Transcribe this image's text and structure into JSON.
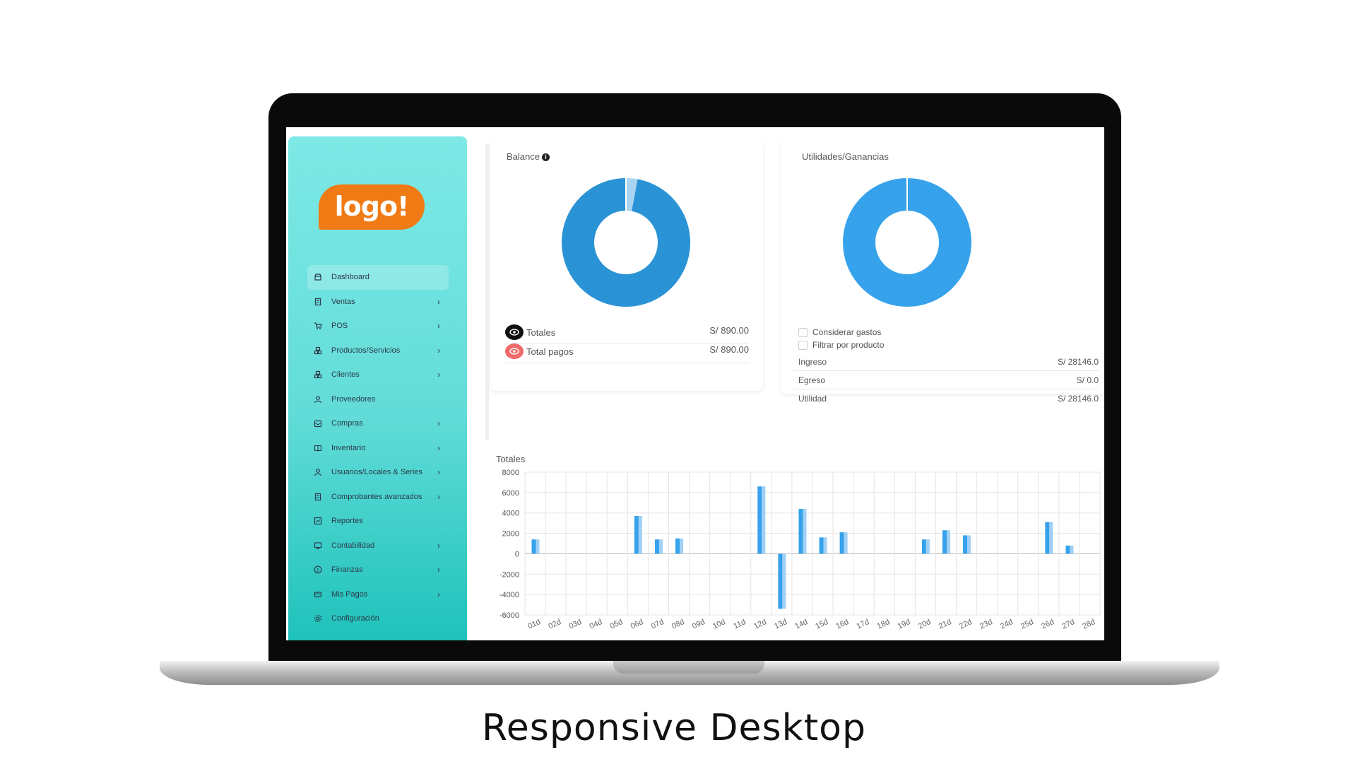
{
  "caption": "Responsive Desktop",
  "logo": {
    "text": "logo!"
  },
  "sidebar": {
    "items": [
      {
        "label": "Dashboard",
        "icon": "store-icon",
        "chevron": false,
        "active": true
      },
      {
        "label": "Ventas",
        "icon": "document-icon",
        "chevron": true
      },
      {
        "label": "POS",
        "icon": "cart-icon",
        "chevron": true
      },
      {
        "label": "Productos/Servicios",
        "icon": "boxes-icon",
        "chevron": true
      },
      {
        "label": "Clientes",
        "icon": "boxes-icon",
        "chevron": true
      },
      {
        "label": "Proveedores",
        "icon": "user-icon",
        "chevron": false
      },
      {
        "label": "Compras",
        "icon": "inbox-icon",
        "chevron": true
      },
      {
        "label": "Inventario",
        "icon": "book-icon",
        "chevron": true
      },
      {
        "label": "Usuarios/Locales & Series",
        "icon": "user-icon",
        "chevron": true
      },
      {
        "label": "Comprobantes avanzados",
        "icon": "document-icon",
        "chevron": true
      },
      {
        "label": "Reportes",
        "icon": "report-icon",
        "chevron": false
      },
      {
        "label": "Contabilidad",
        "icon": "monitor-icon",
        "chevron": true
      },
      {
        "label": "Finanzas",
        "icon": "dollar-icon",
        "chevron": true
      },
      {
        "label": "Mis Pagos",
        "icon": "card-icon",
        "chevron": true
      },
      {
        "label": "Configuración",
        "icon": "gear-icon",
        "chevron": false
      }
    ]
  },
  "balance": {
    "title": "Balance",
    "rows": [
      {
        "label": "Totales",
        "value": "S/ 890.00",
        "icon_color": "#111111"
      },
      {
        "label": "Total pagos",
        "value": "S/ 890.00",
        "icon_color": "#f06a6a"
      }
    ],
    "donut": {
      "segments": [
        0.97,
        0.03
      ],
      "colors": [
        "#2a93d5",
        "#a9d4f3"
      ]
    }
  },
  "utilidades": {
    "title": "Utilidades/Ganancias",
    "checkboxes": [
      "Considerar gastos",
      "Filtrar por producto"
    ],
    "rows": [
      {
        "label": "Ingreso",
        "value": "S/ 28146.0"
      },
      {
        "label": "Egreso",
        "value": "S/ 0.0"
      },
      {
        "label": "Utilidad",
        "value": "S/ 28146.0"
      }
    ],
    "donut": {
      "segments": [
        1.0
      ],
      "colors": [
        "#36a2eb"
      ]
    }
  },
  "chart_data": {
    "type": "bar",
    "title": "Totales",
    "xlabel": "",
    "ylabel": "",
    "ylim": [
      -6000,
      8000
    ],
    "yticks": [
      8000,
      6000,
      4000,
      2000,
      0,
      -2000,
      -4000,
      -6000
    ],
    "categories": [
      "01d",
      "02d",
      "03d",
      "04d",
      "05d",
      "06d",
      "07d",
      "08d",
      "09d",
      "10d",
      "11d",
      "12d",
      "13d",
      "14d",
      "15d",
      "16d",
      "17d",
      "18d",
      "19d",
      "20d",
      "21d",
      "22d",
      "23d",
      "24d",
      "25d",
      "26d",
      "27d",
      "28d"
    ],
    "values": [
      1400,
      0,
      0,
      0,
      0,
      3700,
      1400,
      1500,
      0,
      0,
      0,
      6600,
      -5400,
      4400,
      1600,
      2100,
      0,
      0,
      0,
      1400,
      2300,
      1800,
      0,
      0,
      0,
      3100,
      800,
      0
    ],
    "colors": {
      "bar": "#36a2eb",
      "bar_light": "#9fd0f5",
      "grid": "#e5e5e5"
    },
    "grid": true
  }
}
